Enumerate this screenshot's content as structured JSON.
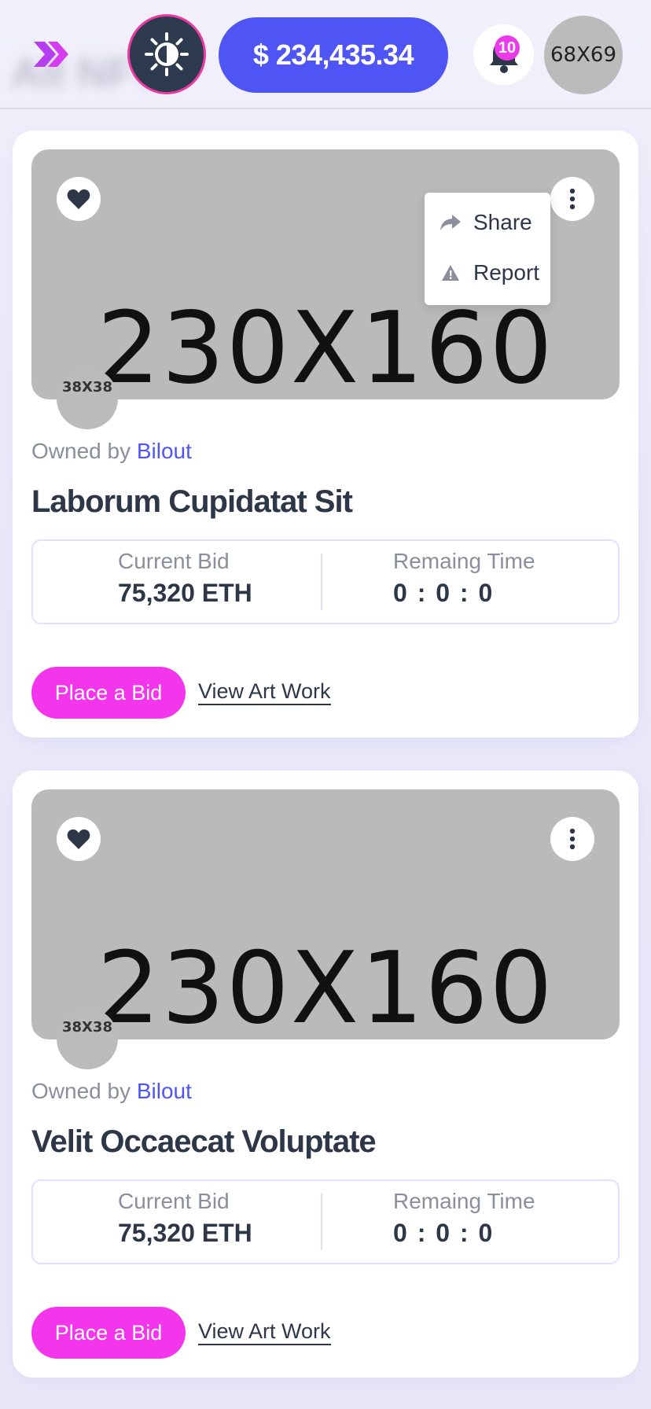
{
  "header": {
    "ghost_title": "All NFTs",
    "balance": "$ 234,435.34",
    "notification_count": "10",
    "avatar_label": "68X69"
  },
  "cards": [
    {
      "image_label": "230X160",
      "creator_avatar_label": "38X38",
      "owned_by_label": "Owned by",
      "owner": "Bilout",
      "title": "Laborum Cupidatat Sit",
      "current_bid_label": "Current Bid",
      "current_bid": "75,320 ETH",
      "remaining_label": "Remaing Time",
      "remaining_time": "0 : 0 : 0",
      "bid_button": "Place a Bid",
      "view_link": "View Art Work",
      "menu": {
        "share": "Share",
        "report": "Report"
      }
    },
    {
      "image_label": "230X160",
      "creator_avatar_label": "38X38",
      "owned_by_label": "Owned by",
      "owner": "Bilout",
      "title": "Velit Occaecat Voluptate",
      "current_bid_label": "Current Bid",
      "current_bid": "75,320 ETH",
      "remaining_label": "Remaing Time",
      "remaining_time": "0 : 0 : 0",
      "bid_button": "Place a Bid",
      "view_link": "View Art Work"
    }
  ],
  "colors": {
    "primary": "#4f55f4",
    "accent_pink": "#f336eb",
    "theme_button_bg": "#2e3a4d",
    "text_dark": "#2d3748",
    "text_muted": "#8a8f9b"
  },
  "icons": {
    "menu": "double-chevron-right-icon",
    "theme": "sun-moon-icon",
    "bell": "bell-icon",
    "like": "heart-icon",
    "more": "more-vertical-icon",
    "share": "share-arrow-icon",
    "report": "warning-icon"
  }
}
